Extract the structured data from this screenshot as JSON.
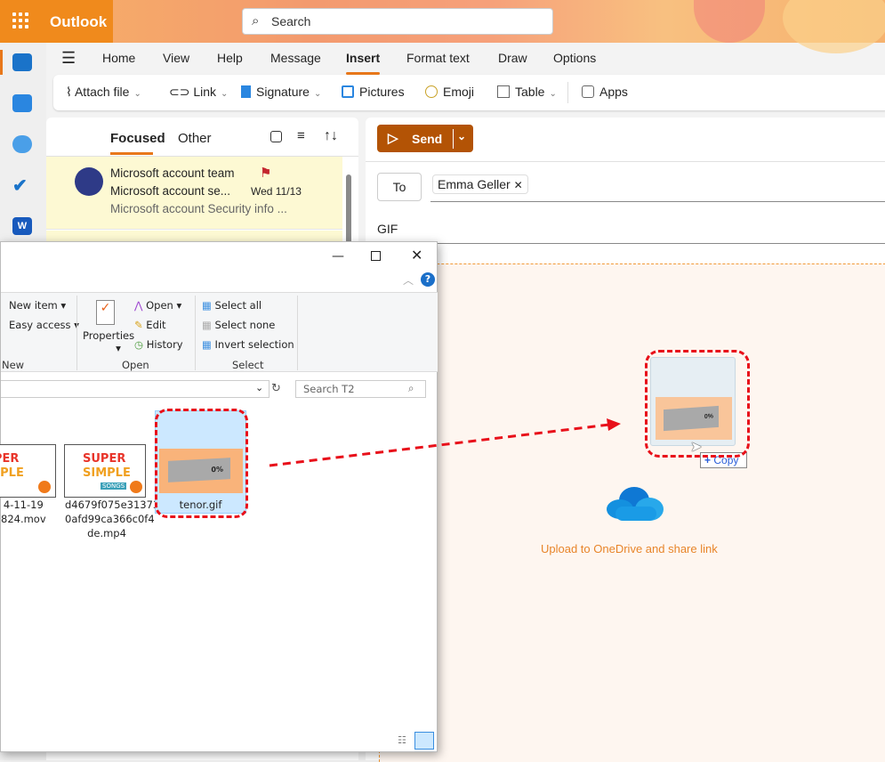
{
  "app": {
    "name": "Outlook",
    "search_placeholder": "Search"
  },
  "tabs": [
    "Home",
    "View",
    "Help",
    "Message",
    "Insert",
    "Format text",
    "Draw",
    "Options"
  ],
  "active_tab": "Insert",
  "ribbon": {
    "attach": "Attach file",
    "link": "Link",
    "signature": "Signature",
    "pictures": "Pictures",
    "emoji": "Emoji",
    "table": "Table",
    "apps": "Apps"
  },
  "maillist": {
    "focused": "Focused",
    "other": "Other",
    "items": [
      {
        "sender": "Microsoft account team",
        "subject": "Microsoft account se...",
        "date": "Wed 11/13",
        "preview": "Microsoft account Security info ..."
      }
    ]
  },
  "compose": {
    "send": "Send",
    "to_label": "To",
    "recipient": "Emma Geller",
    "subject": "GIF",
    "upload_text": "Upload to OneDrive and share link"
  },
  "explorer": {
    "new_item": "New item",
    "easy_access": "Easy access",
    "group_new": "New",
    "properties": "Properties",
    "open": "Open",
    "edit": "Edit",
    "history": "History",
    "group_open": "Open",
    "select_all": "Select all",
    "select_none": "Select none",
    "invert_selection": "Invert selection",
    "group_select": "Select",
    "search_placeholder": "Search T2",
    "files": [
      {
        "name": "...4-11-19\n...824.mov",
        "l1": "4-11-19",
        "l2": "824.mov"
      },
      {
        "l1": "d4679f075e31373",
        "l2": "0afd99ca366c0f4",
        "l3": "de.mp4"
      },
      {
        "l1": "tenor.gif"
      }
    ],
    "thumb_text": {
      "super": "SUPER",
      "simple": "SIMPLE",
      "songs": "SONGS",
      "percent": "0%"
    }
  },
  "drag": {
    "copy_label": "Copy"
  },
  "colors": {
    "brand": "#f08a1c",
    "send": "#b35305",
    "annotation": "#e8101a",
    "upload": "#e8852a"
  }
}
